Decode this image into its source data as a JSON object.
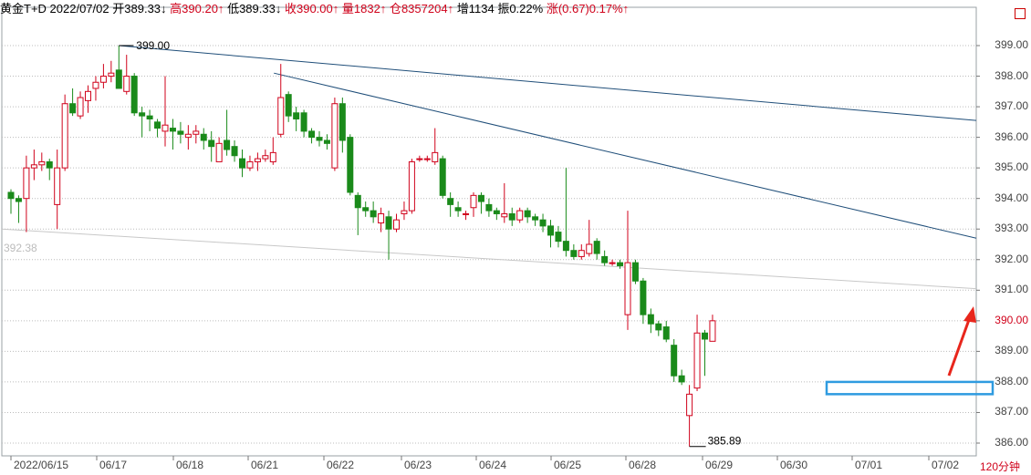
{
  "header": {
    "instrument": "黄金T+D",
    "date": "2022/07/02",
    "open_label": "开",
    "open_value": "389.33↓",
    "high_label": "高",
    "high_value": "390.20↑",
    "low_label": "低",
    "low_value": "389.33↓",
    "close_label": "收",
    "close_value": "390.00↑",
    "volume_label": "量",
    "volume_value": "1832↑",
    "position_label": "仓",
    "position_value": "8357204↑",
    "increase_label": "增",
    "increase_value": "1134",
    "amplitude_label": "振",
    "amplitude_value": "0.22%",
    "change_label": "涨",
    "change_value": "(0.67)0.17%↑"
  },
  "period_label": "120分钟",
  "colors": {
    "up": "#d0021b",
    "down": "#1a8a1a",
    "trend": "#1f4e79",
    "box": "#2f9be0",
    "arrow": "#e8261c"
  },
  "annotations": {
    "high_label": "399.00",
    "low_label": "385.89",
    "left_price_label": "392.38",
    "current_price": "390.00"
  },
  "chart_data": {
    "type": "candlestick",
    "y_ticks": [
      "399.00",
      "398.00",
      "397.00",
      "396.00",
      "395.00",
      "394.00",
      "393.00",
      "392.00",
      "391.00",
      "390.00",
      "389.00",
      "388.00",
      "387.00",
      "386.00"
    ],
    "ylim": [
      385.5,
      399.8
    ],
    "x_labels": [
      "2022/06/15",
      "06/17",
      "06/18",
      "06/21",
      "06/22",
      "06/23",
      "06/24",
      "06/25",
      "06/28",
      "06/29",
      "06/30",
      "07/01",
      "07/02"
    ],
    "candles": [
      [
        394.2,
        394.0,
        394.3,
        393.5
      ],
      [
        394.0,
        393.9,
        394.1,
        393.2
      ],
      [
        394.0,
        395.0,
        395.4,
        392.9
      ],
      [
        395.0,
        395.1,
        395.6,
        394.6
      ],
      [
        395.1,
        395.2,
        395.5,
        394.9
      ],
      [
        395.2,
        395.0,
        395.3,
        394.6
      ],
      [
        393.8,
        395.0,
        395.6,
        393.0
      ],
      [
        395.0,
        397.1,
        397.4,
        394.9
      ],
      [
        397.1,
        396.8,
        397.6,
        396.7
      ],
      [
        396.7,
        397.3,
        397.5,
        396.6
      ],
      [
        397.2,
        397.5,
        397.7,
        396.8
      ],
      [
        397.6,
        397.8,
        398.0,
        397.2
      ],
      [
        397.8,
        398.0,
        398.4,
        397.6
      ],
      [
        398.0,
        398.1,
        398.5,
        397.8
      ],
      [
        398.2,
        397.6,
        399.0,
        397.6
      ],
      [
        397.5,
        398.0,
        398.7,
        397.4
      ],
      [
        398.0,
        396.8,
        398.1,
        396.7
      ],
      [
        396.8,
        396.7,
        397.0,
        396.0
      ],
      [
        396.7,
        396.6,
        396.9,
        396.2
      ],
      [
        396.5,
        396.3,
        396.6,
        396.0
      ],
      [
        396.2,
        396.4,
        398.0,
        395.7
      ],
      [
        396.3,
        396.2,
        396.6,
        395.6
      ],
      [
        396.2,
        396.1,
        396.5,
        395.8
      ],
      [
        396.0,
        396.1,
        396.4,
        395.6
      ],
      [
        396.1,
        396.2,
        396.4,
        395.8
      ],
      [
        396.1,
        395.9,
        396.3,
        395.6
      ],
      [
        395.9,
        395.7,
        396.2,
        395.2
      ],
      [
        395.2,
        395.8,
        396.0,
        395.2
      ],
      [
        395.9,
        395.6,
        396.9,
        395.4
      ],
      [
        395.7,
        395.4,
        395.9,
        395.2
      ],
      [
        395.3,
        395.0,
        395.6,
        394.7
      ],
      [
        395.0,
        395.2,
        395.4,
        394.9
      ],
      [
        395.2,
        395.3,
        395.5,
        394.9
      ],
      [
        395.3,
        395.4,
        395.6,
        395.2
      ],
      [
        395.2,
        395.5,
        396.0,
        395.1
      ],
      [
        396.1,
        397.3,
        398.4,
        396.0
      ],
      [
        397.4,
        396.7,
        397.5,
        396.5
      ],
      [
        396.8,
        396.6,
        397.0,
        396.2
      ],
      [
        396.8,
        396.2,
        396.9,
        396.0
      ],
      [
        396.2,
        396.0,
        396.3,
        395.8
      ],
      [
        396.0,
        395.9,
        396.2,
        395.7
      ],
      [
        395.9,
        395.8,
        396.1,
        395.6
      ],
      [
        395.0,
        397.1,
        397.3,
        394.9
      ],
      [
        397.1,
        395.9,
        397.3,
        395.5
      ],
      [
        396.0,
        394.2,
        396.1,
        394.1
      ],
      [
        394.1,
        393.7,
        394.2,
        392.8
      ],
      [
        393.7,
        393.6,
        393.9,
        393.4
      ],
      [
        393.6,
        393.4,
        393.9,
        393.2
      ],
      [
        393.2,
        393.5,
        393.7,
        392.9
      ],
      [
        393.4,
        393.0,
        393.6,
        392.0
      ],
      [
        393.0,
        393.3,
        393.5,
        392.9
      ],
      [
        393.5,
        393.6,
        393.9,
        393.3
      ],
      [
        393.6,
        395.2,
        395.3,
        393.5
      ],
      [
        395.3,
        395.3,
        395.4,
        395.2
      ],
      [
        395.3,
        395.3,
        395.4,
        395.2
      ],
      [
        395.2,
        395.5,
        396.3,
        395.1
      ],
      [
        395.3,
        394.1,
        395.4,
        394.0
      ],
      [
        394.0,
        393.8,
        394.2,
        393.4
      ],
      [
        393.7,
        393.6,
        393.9,
        393.4
      ],
      [
        393.5,
        393.5,
        393.6,
        393.3
      ],
      [
        393.7,
        394.1,
        394.2,
        393.4
      ],
      [
        394.1,
        393.9,
        394.2,
        393.5
      ],
      [
        393.8,
        393.6,
        394.0,
        393.4
      ],
      [
        393.6,
        393.5,
        393.7,
        393.3
      ],
      [
        393.4,
        393.5,
        394.5,
        393.2
      ],
      [
        393.5,
        393.3,
        393.7,
        393.1
      ],
      [
        393.3,
        393.6,
        393.7,
        393.2
      ],
      [
        393.6,
        393.4,
        393.7,
        393.2
      ],
      [
        393.4,
        393.3,
        393.5,
        393.1
      ],
      [
        393.3,
        393.1,
        393.5,
        392.9
      ],
      [
        393.1,
        392.8,
        393.3,
        392.4
      ],
      [
        392.9,
        392.6,
        393.1,
        392.4
      ],
      [
        392.6,
        392.3,
        395.0,
        392.1
      ],
      [
        392.3,
        392.1,
        392.5,
        392.0
      ],
      [
        392.1,
        392.3,
        392.5,
        392.0
      ],
      [
        392.2,
        392.5,
        393.3,
        392.1
      ],
      [
        392.6,
        392.2,
        392.7,
        392.0
      ],
      [
        392.1,
        391.9,
        392.3,
        391.8
      ],
      [
        391.9,
        391.9,
        392.0,
        391.8
      ],
      [
        391.9,
        391.8,
        392.0,
        391.7
      ],
      [
        390.2,
        391.9,
        393.6,
        389.7
      ],
      [
        391.9,
        391.3,
        392.0,
        391.2
      ],
      [
        391.3,
        390.2,
        391.4,
        389.9
      ],
      [
        390.2,
        389.9,
        390.4,
        389.6
      ],
      [
        389.9,
        389.7,
        390.0,
        389.5
      ],
      [
        389.8,
        389.4,
        390.0,
        389.3
      ],
      [
        389.2,
        388.2,
        389.4,
        388.0
      ],
      [
        388.2,
        388.0,
        388.4,
        387.9
      ],
      [
        386.9,
        387.6,
        387.9,
        385.89
      ],
      [
        387.8,
        389.6,
        390.2,
        387.7
      ],
      [
        389.6,
        389.4,
        389.7,
        388.2
      ],
      [
        389.33,
        390.0,
        390.2,
        389.33
      ]
    ]
  }
}
